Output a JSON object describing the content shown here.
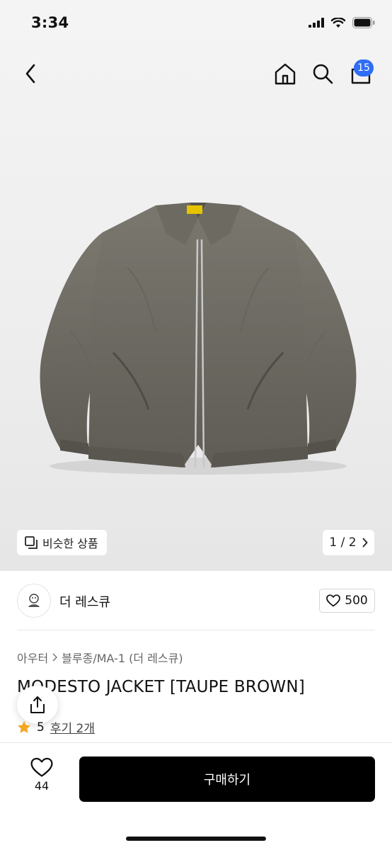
{
  "status_bar": {
    "time": "3:34"
  },
  "nav": {
    "cart_count": "15"
  },
  "gallery": {
    "similar_label": "비슷한 상품",
    "page_indicator": "1 / 2"
  },
  "shop": {
    "name": "더 레스큐",
    "likes": "500"
  },
  "product": {
    "breadcrumb": [
      "아우터",
      "블루종/MA-1 (더 레스큐)"
    ],
    "title": "MODESTO JACKET [TAUPE BROWN]",
    "rating": "5",
    "reviews_link": "후기 2개"
  },
  "bottom_bar": {
    "wish_count": "44",
    "buy_label": "구매하기"
  },
  "colors": {
    "accent_blue": "#2f6df6",
    "star": "#f5a623",
    "buy_button": "#000000",
    "jacket": "#6f6c64"
  },
  "icons": [
    "back-icon",
    "home-icon",
    "search-icon",
    "cart-icon",
    "similar-items-icon",
    "chevron-right-icon",
    "heart-icon",
    "share-icon",
    "star-icon"
  ]
}
